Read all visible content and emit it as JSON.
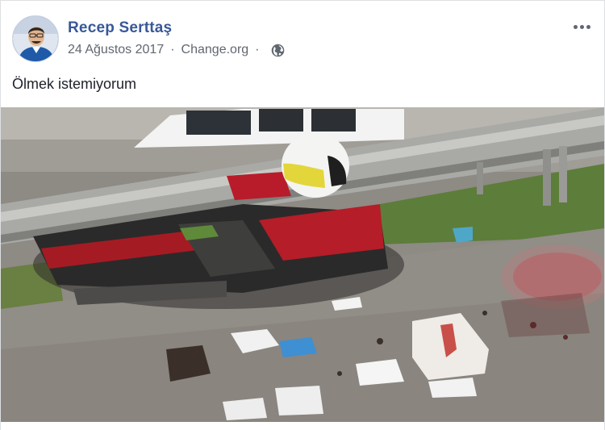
{
  "post": {
    "author_name": "Recep Serttaş",
    "date": "24 Ağustos 2017",
    "source": "Change.org",
    "separator": "·",
    "privacy_icon": "globe-icon",
    "more_icon": "more-options-icon",
    "text": "Ölmek istemiyorum"
  },
  "colors": {
    "author_name": "#385898",
    "meta_text": "#616770",
    "body_text": "#1d2129"
  }
}
